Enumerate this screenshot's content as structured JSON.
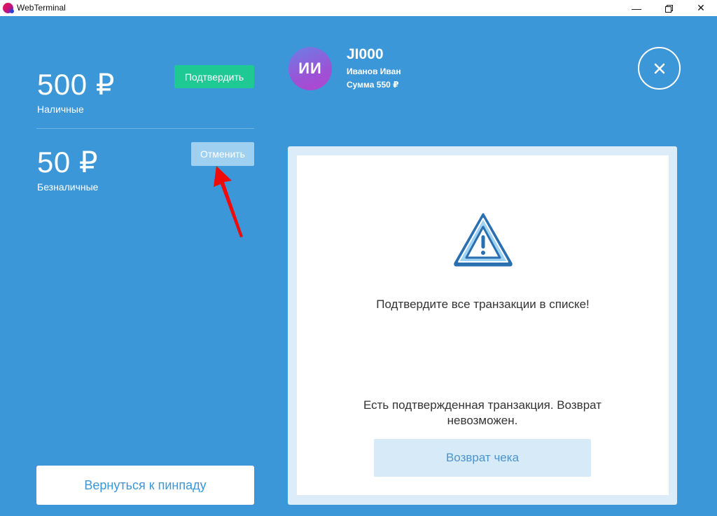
{
  "window": {
    "title": "WebTerminal",
    "controls": {
      "minimize": "—",
      "close": "✕"
    }
  },
  "payments": [
    {
      "amount": "500 ₽",
      "method": "Наличные",
      "action": "Подтвердить"
    },
    {
      "amount": "50 ₽",
      "method": "Безналичные",
      "action": "Отменить"
    }
  ],
  "back_button": "Вернуться к пинпаду",
  "customer": {
    "initials": "ИИ",
    "id": "JI000",
    "name": "Иванов Иван",
    "sum": "Сумма 550 ₽"
  },
  "card": {
    "icon": "warning-triangle-icon",
    "message": "Подтвердите все транзакции в списке!",
    "note": "Есть подтвержденная транзакция. Возврат невозможен.",
    "refund_button": "Возврат чека"
  },
  "colors": {
    "background": "#3b97d7",
    "confirm": "#1ec994",
    "cancel": "#9fd0ef",
    "annotation_arrow": "#f00a0a"
  }
}
